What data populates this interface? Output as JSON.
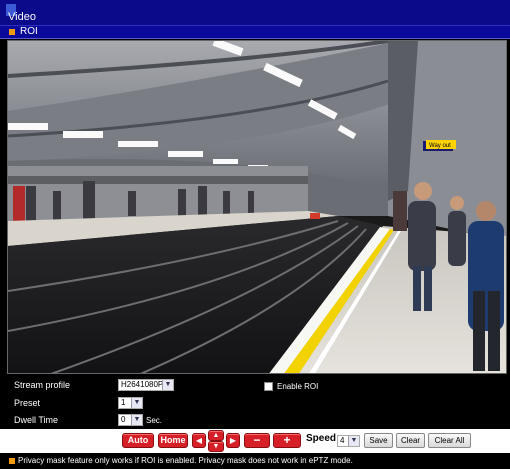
{
  "window": {
    "title": "Video"
  },
  "roi_bar": {
    "label": "ROI"
  },
  "controls": {
    "stream_profile": {
      "label": "Stream profile",
      "value": "H2641080P"
    },
    "enable_roi": {
      "label": "Enable ROI",
      "checked": false
    },
    "preset": {
      "label": "Preset",
      "value": "1"
    },
    "dwell_time": {
      "label": "Dwell Time",
      "value": "0",
      "unit": "Sec."
    }
  },
  "ptz": {
    "auto_label": "Auto",
    "home_label": "Home",
    "speed_label": "Speed",
    "speed_value": "4",
    "save_label": "Save",
    "clear_label": "Clear",
    "clear_all_label": "Clear All",
    "zoom_out_symbol": "−",
    "zoom_in_symbol": "+"
  },
  "note": {
    "text": "Privacy mask feature only works if ROI is enabled. Privacy mask does not work in ePTZ mode."
  },
  "video_signs": {
    "way_out": "Way out"
  },
  "colors": {
    "accent_red": "#d61f26",
    "title_blue": "#0a0a8a",
    "bullet_orange": "#f39c12"
  }
}
